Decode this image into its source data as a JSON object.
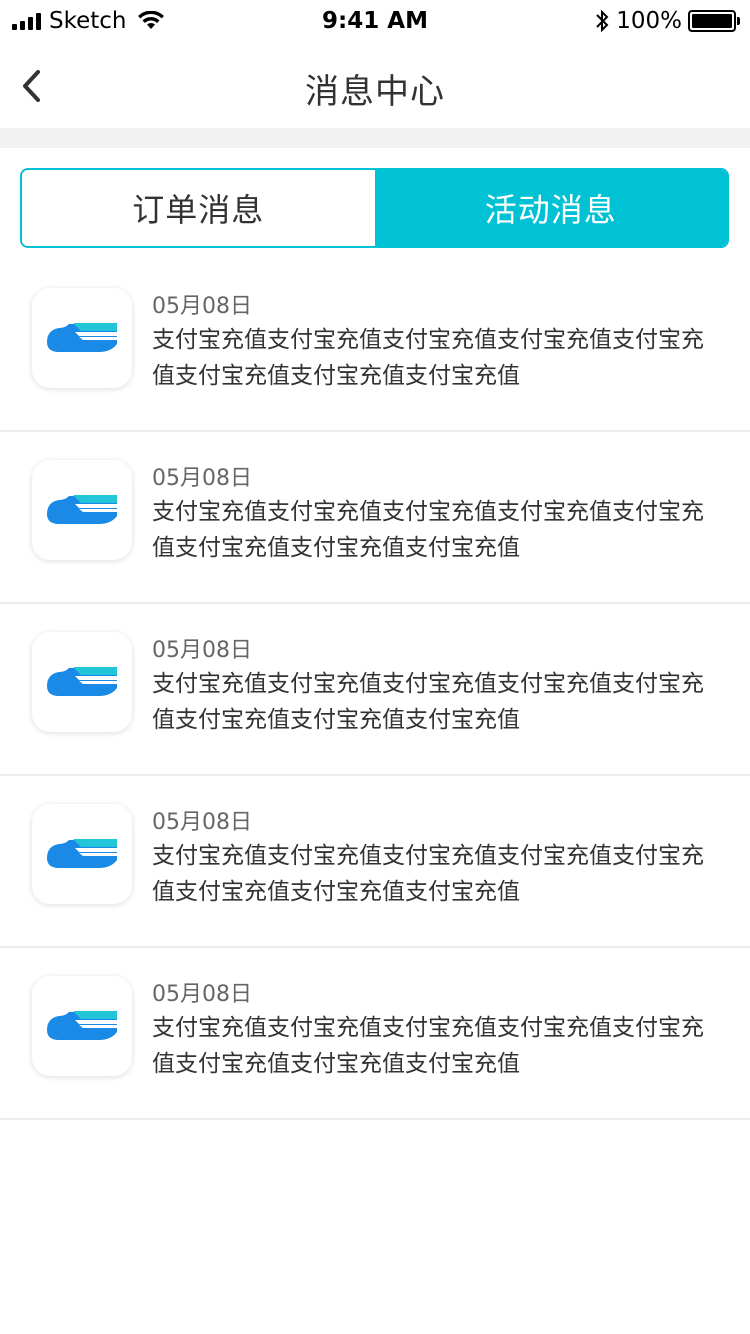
{
  "status_bar": {
    "carrier": "Sketch",
    "time": "9:41 AM",
    "battery_percent": "100%",
    "icons": [
      "signal-icon",
      "wifi-icon",
      "bluetooth-icon",
      "battery-icon"
    ]
  },
  "nav": {
    "title": "消息中心",
    "back_icon": "chevron-left-icon"
  },
  "tabs": [
    {
      "label": "订单消息",
      "active": false
    },
    {
      "label": "活动消息",
      "active": true
    }
  ],
  "colors": {
    "accent": "#00c2d4",
    "logo_blue": "#1a8ae6",
    "logo_cyan": "#22c6d8"
  },
  "messages": [
    {
      "date": "05月08日",
      "text": "支付宝充值支付宝充值支付宝充值支付宝充值支付宝充值支付宝充值支付宝充值支付宝充值",
      "icon": "app-logo-icon"
    },
    {
      "date": "05月08日",
      "text": "支付宝充值支付宝充值支付宝充值支付宝充值支付宝充值支付宝充值支付宝充值支付宝充值",
      "icon": "app-logo-icon"
    },
    {
      "date": "05月08日",
      "text": "支付宝充值支付宝充值支付宝充值支付宝充值支付宝充值支付宝充值支付宝充值支付宝充值",
      "icon": "app-logo-icon"
    },
    {
      "date": "05月08日",
      "text": "支付宝充值支付宝充值支付宝充值支付宝充值支付宝充值支付宝充值支付宝充值支付宝充值",
      "icon": "app-logo-icon"
    },
    {
      "date": "05月08日",
      "text": "支付宝充值支付宝充值支付宝充值支付宝充值支付宝充值支付宝充值支付宝充值支付宝充值",
      "icon": "app-logo-icon"
    }
  ]
}
